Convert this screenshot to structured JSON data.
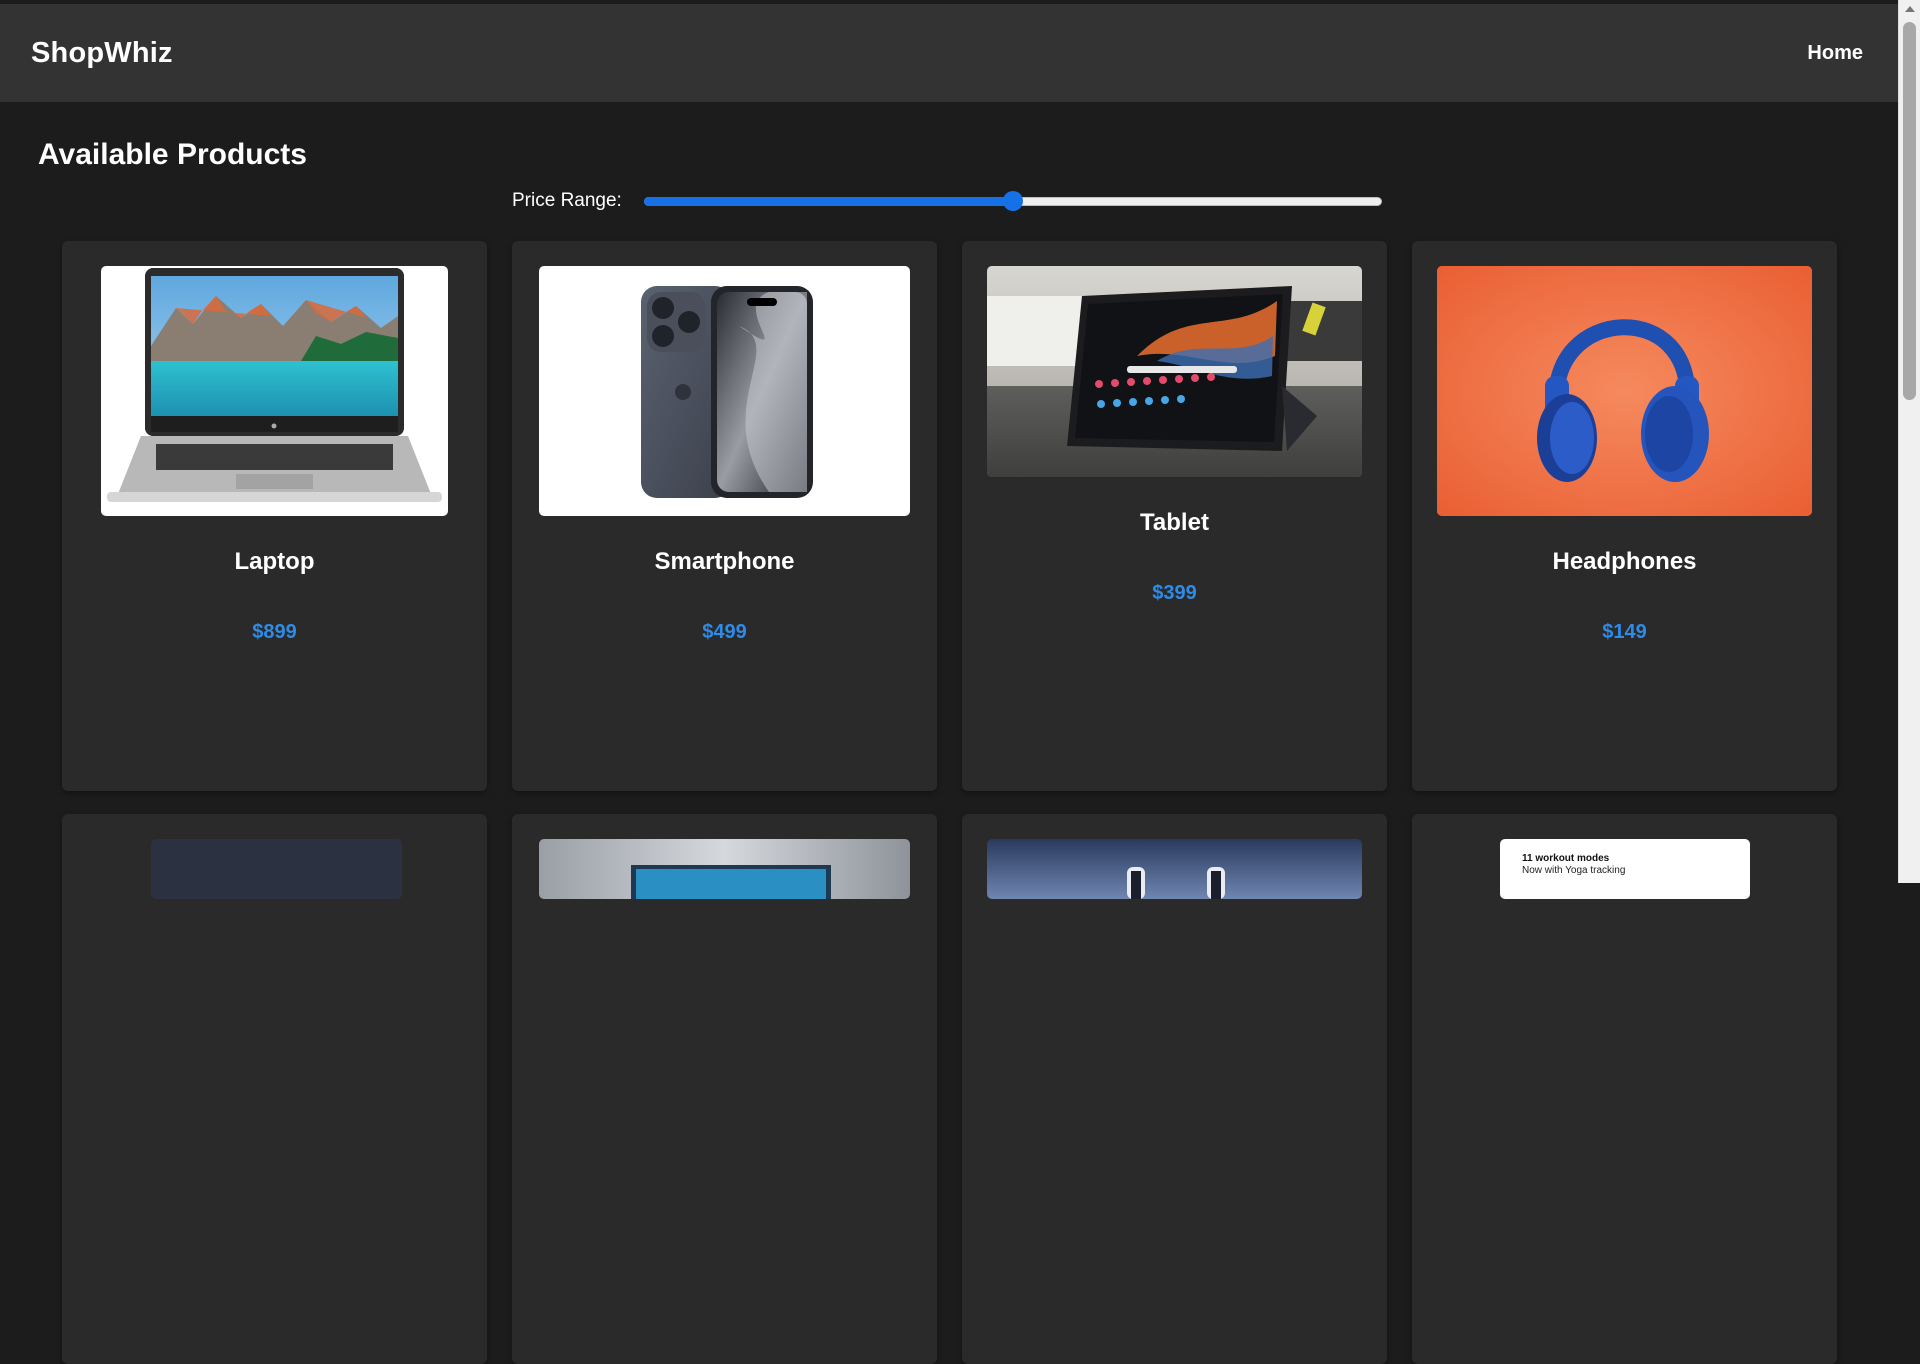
{
  "app": {
    "brand": "ShopWhiz"
  },
  "nav": {
    "home_label": "Home"
  },
  "main": {
    "title": "Available Products",
    "filter": {
      "label": "Price Range:",
      "level_fraction": 0.5
    }
  },
  "products": [
    {
      "name": "Laptop",
      "price": "$899"
    },
    {
      "name": "Smartphone",
      "price": "$499"
    },
    {
      "name": "Tablet",
      "price": "$399"
    },
    {
      "name": "Headphones",
      "price": "$149"
    }
  ],
  "partial_products": {
    "watch_promo_line1": "11 workout modes",
    "watch_promo_line2": "Now with Yoga tracking"
  },
  "colors": {
    "background": "#1c1c1c",
    "header": "#333333",
    "card": "#2a2a2a",
    "accent": "#1671e6",
    "price": "#2e8be8"
  }
}
